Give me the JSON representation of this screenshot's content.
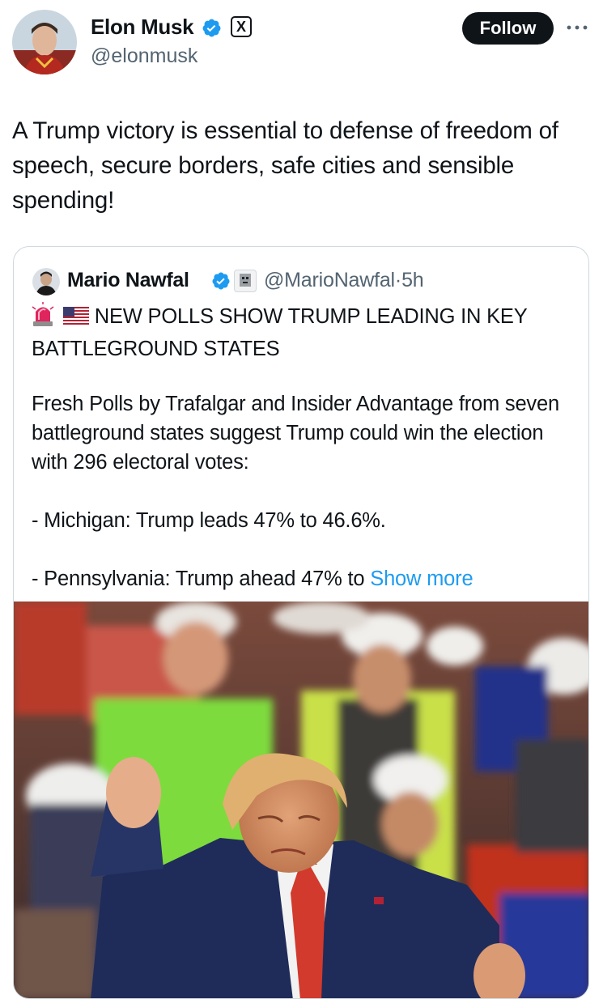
{
  "author": {
    "name": "Elon Musk",
    "handle": "@elonmusk",
    "verified": true,
    "affiliation_badge": "X",
    "avatar": "avatar-icon"
  },
  "header": {
    "follow_label": "Follow",
    "more_icon": "more-icon"
  },
  "tweet": {
    "text": "A Trump victory is essential to defense of freedom of speech, secure borders, safe cities and sensible spending!"
  },
  "quote": {
    "author_name": "Mario Nawfal",
    "author_handle": "@MarioNawfal",
    "time": "5h",
    "verified": true,
    "headline_icons": [
      "siren-icon",
      "us-flag-icon"
    ],
    "headline": "NEW POLLS SHOW TRUMP LEADING IN KEY BATTLEGROUND STATES",
    "body_intro": "Fresh Polls by Trafalgar and Insider Advantage from seven battleground states suggest Trump could win the election with 296 electoral votes:",
    "body_item_1": "- Michigan: Trump leads 47% to 46.6%.",
    "body_item_2": "- Pennsylvania: Trump ahead 47% to",
    "show_more_label": "Show more",
    "image": "photo-trump-rally"
  },
  "colors": {
    "text": "#0f1419",
    "secondary": "#536471",
    "link": "#1d9bf0",
    "verified": "#1d9bf0",
    "border": "#cfd9de",
    "button_bg": "#0f1419"
  }
}
